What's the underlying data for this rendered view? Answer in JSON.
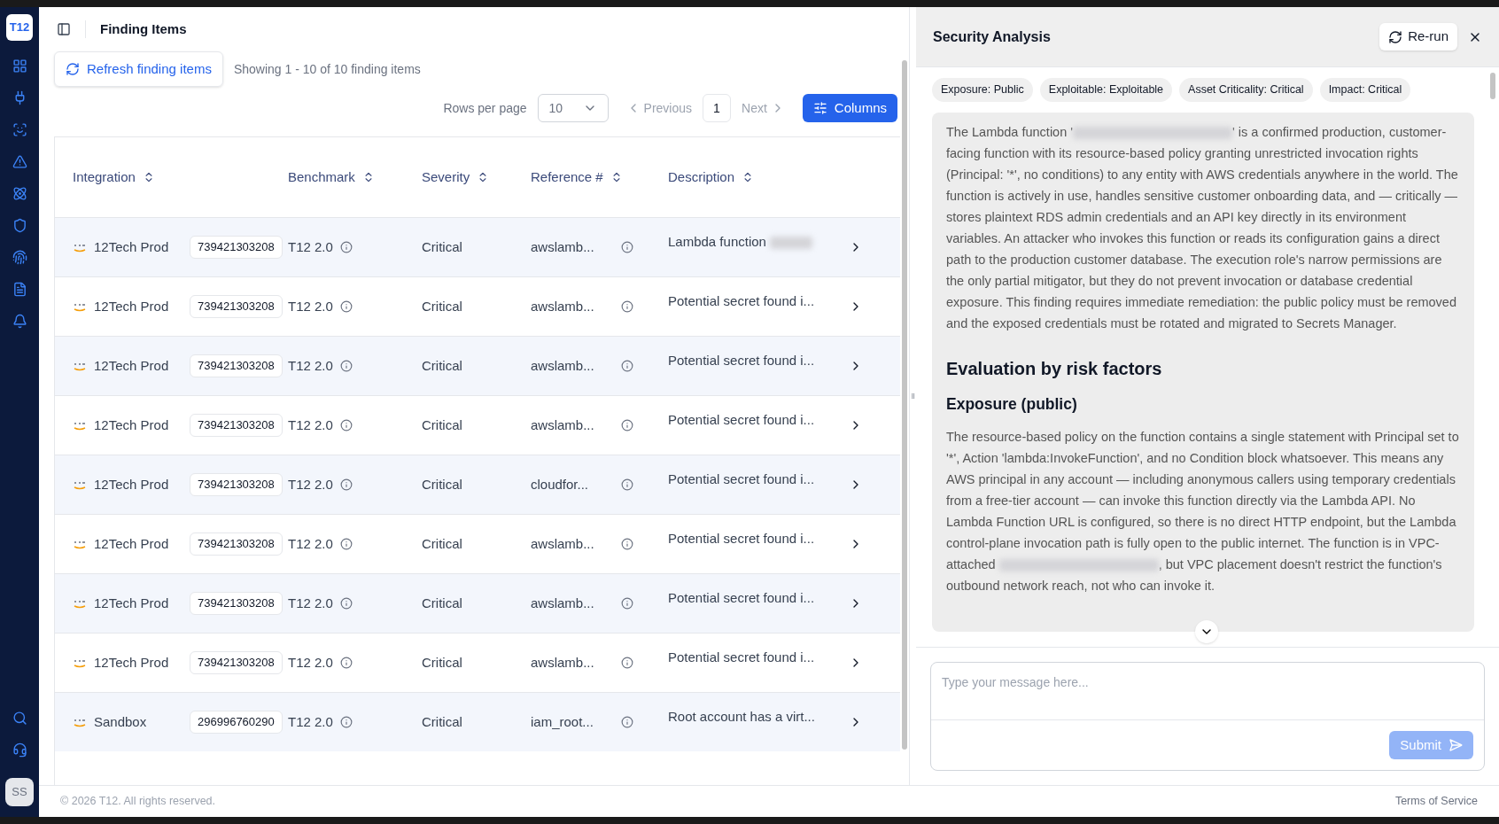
{
  "sidebar": {
    "logo": "T12",
    "items": [
      {
        "kind": "grid"
      },
      {
        "kind": "plug"
      },
      {
        "kind": "scan"
      },
      {
        "kind": "alert"
      },
      {
        "kind": "atom"
      },
      {
        "kind": "shield"
      },
      {
        "kind": "fingerprint"
      },
      {
        "kind": "file"
      },
      {
        "kind": "bell"
      }
    ],
    "bottom_items": [
      {
        "kind": "search"
      },
      {
        "kind": "headset"
      }
    ],
    "avatar": "SS"
  },
  "header": {
    "title": "Finding Items"
  },
  "toolbar": {
    "refresh": "Refresh finding items",
    "showing": "Showing 1 - 10 of 10 finding items",
    "rows_per_page_label": "Rows per page",
    "rows_per_page": "10",
    "previous": "Previous",
    "page": "1",
    "next": "Next",
    "columns": "Columns"
  },
  "table": {
    "columns": [
      "Integration",
      "Benchmark",
      "Severity",
      "Reference #",
      "Description"
    ],
    "rows": [
      {
        "integration": "12Tech Prod",
        "account": "739421303208",
        "benchmark": "T12 2.0",
        "severity": "Critical",
        "reference": "awslamb...",
        "description": "Lambda function",
        "redacted": true
      },
      {
        "integration": "12Tech Prod",
        "account": "739421303208",
        "benchmark": "T12 2.0",
        "severity": "Critical",
        "reference": "awslamb...",
        "description": "Potential secret found i...",
        "redacted": false
      },
      {
        "integration": "12Tech Prod",
        "account": "739421303208",
        "benchmark": "T12 2.0",
        "severity": "Critical",
        "reference": "awslamb...",
        "description": "Potential secret found i...",
        "redacted": false
      },
      {
        "integration": "12Tech Prod",
        "account": "739421303208",
        "benchmark": "T12 2.0",
        "severity": "Critical",
        "reference": "awslamb...",
        "description": "Potential secret found i...",
        "redacted": false
      },
      {
        "integration": "12Tech Prod",
        "account": "739421303208",
        "benchmark": "T12 2.0",
        "severity": "Critical",
        "reference": "cloudfor...",
        "description": "Potential secret found i...",
        "redacted": false
      },
      {
        "integration": "12Tech Prod",
        "account": "739421303208",
        "benchmark": "T12 2.0",
        "severity": "Critical",
        "reference": "awslamb...",
        "description": "Potential secret found i...",
        "redacted": false
      },
      {
        "integration": "12Tech Prod",
        "account": "739421303208",
        "benchmark": "T12 2.0",
        "severity": "Critical",
        "reference": "awslamb...",
        "description": "Potential secret found i...",
        "redacted": false
      },
      {
        "integration": "12Tech Prod",
        "account": "739421303208",
        "benchmark": "T12 2.0",
        "severity": "Critical",
        "reference": "awslamb...",
        "description": "Potential secret found i...",
        "redacted": false
      },
      {
        "integration": "Sandbox",
        "account": "296996760290",
        "benchmark": "T12 2.0",
        "severity": "Critical",
        "reference": "iam_root...",
        "description": "Root account has a virt...",
        "redacted": false
      }
    ]
  },
  "footer": {
    "copyright": "© 2026 T12. All rights reserved.",
    "terms": "Terms of Service"
  },
  "panel": {
    "title": "Security Analysis",
    "rerun": "Re-run",
    "tags": [
      "Exposure: Public",
      "Exploitable: Exploitable",
      "Asset Criticality: Critical",
      "Impact: Critical"
    ],
    "blocks": [
      {
        "kind": "paragraph",
        "before": "The Lambda function '",
        "after": "' is a confirmed production, customer-facing function with its resource-based policy granting unrestricted invocation rights (Principal: '*', no conditions) to any entity with AWS credentials anywhere in the world. The function is actively in use, handles sensitive customer onboarding data, and — critically — stores plaintext RDS admin credentials and an API key directly in its environment variables. An attacker who invokes this function or reads its configuration gains a direct path to the production customer database. The execution role's narrow permissions are the only partial mitigator, but they do not prevent invocation or database credential exposure. This finding requires immediate remediation: the public policy must be removed and the exposed credentials must be rotated and migrated to Secrets Manager."
      },
      {
        "kind": "h2",
        "text": "Evaluation by risk factors"
      },
      {
        "kind": "h3",
        "text": "Exposure (public)"
      },
      {
        "kind": "paragraph",
        "before": "The resource-based policy on the function contains a single statement with Principal set to '*', Action 'lambda:InvokeFunction', and no Condition block whatsoever. This means any AWS principal in any account — including anonymous callers using temporary credentials from a free-tier account — can invoke this function directly via the Lambda API. No Lambda Function URL is configured, so there is no direct HTTP endpoint, but the Lambda control-plane invocation path is fully open to the public internet. The function is in VPC-attached ",
        "after": ", but VPC placement doesn't restrict the function's outbound network reach, not who can invoke it."
      }
    ],
    "message_placeholder": "Type your message here...",
    "submit": "Submit",
    "submit_disabled": true
  }
}
